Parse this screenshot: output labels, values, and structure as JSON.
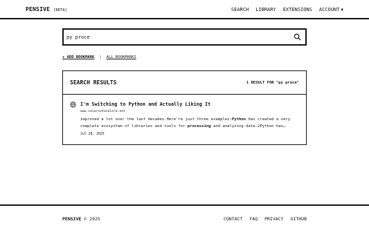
{
  "header": {
    "brand": "PENSIVE",
    "badge": "[BETA]",
    "nav": {
      "search": "SEARCH",
      "library": "LIBRARY",
      "extensions": "EXTENSIONS",
      "account": "ACCOUNT",
      "account_caret": "▼"
    }
  },
  "search": {
    "value": "py proce",
    "icon": "search-icon"
  },
  "actions": {
    "add_bookmark": "+ ADD BOOKMARK",
    "separator": "|",
    "all_bookmarks": "ALL BOOKMARKS"
  },
  "results": {
    "heading": "SEARCH RESULTS",
    "count_text": "1 RESULT FOR \"py proce\"",
    "items": [
      {
        "icon": "globe-icon",
        "title": "I'm Switching to Python and Actually Liking It",
        "url": "www.cesarsotovalero.net",
        "snippet_parts": [
          {
            "text": "improved a lot over the last decades.Here're just three examples:",
            "bold": false
          },
          {
            "text": "Python",
            "bold": true
          },
          {
            "text": " has created a very complete ecosystem of libraries and tools for ",
            "bold": false
          },
          {
            "text": "processing",
            "bold": true
          },
          {
            "text": " and analyzing data.2Python has…",
            "bold": false
          }
        ],
        "date": "Jul 28, 2025"
      }
    ]
  },
  "footer": {
    "brand": "PENSIVE",
    "copyright": "© 2025",
    "links": {
      "contact": "CONTACT",
      "faq": "FAQ",
      "privacy": "PRIVACY",
      "github": "GITHUB"
    }
  }
}
